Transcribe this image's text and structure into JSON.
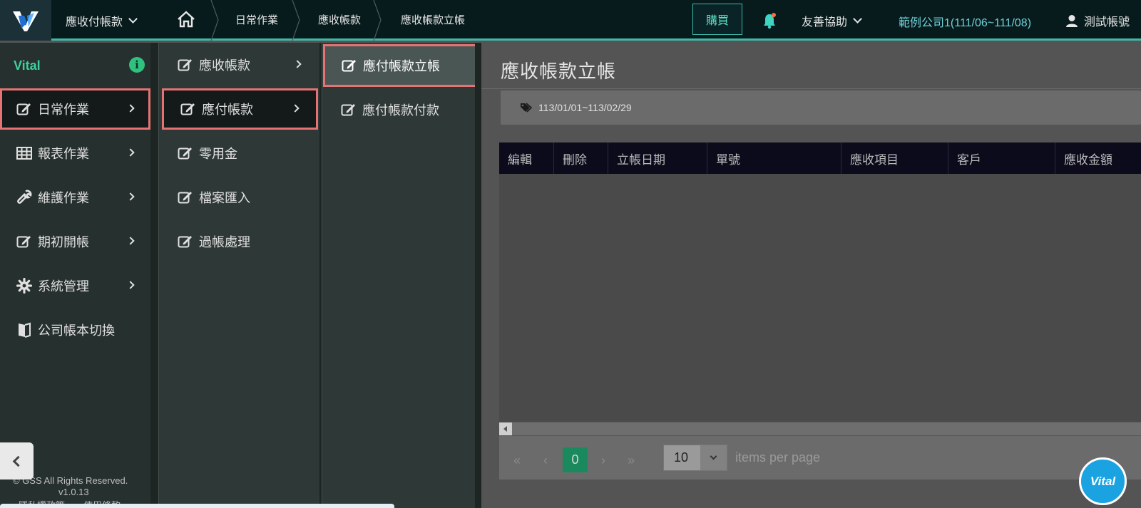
{
  "topbar": {
    "module": "應收付帳款",
    "breadcrumb": [
      "日常作業",
      "應收帳款",
      "應收帳款立帳"
    ],
    "buy_label": "購買",
    "help_label": "友善協助",
    "company": "範例公司1(111/06~111/08)",
    "user": "測試帳號"
  },
  "sidebar": {
    "brand": "Vital",
    "items": [
      {
        "label": "日常作業",
        "icon": "edit-icon"
      },
      {
        "label": "報表作業",
        "icon": "table-icon"
      },
      {
        "label": "維護作業",
        "icon": "wrench-icon"
      },
      {
        "label": "期初開帳",
        "icon": "edit-icon"
      },
      {
        "label": "系統管理",
        "icon": "gear-icon"
      },
      {
        "label": "公司帳本切換",
        "icon": "book-icon"
      }
    ],
    "footer": {
      "copyright": "© GSS All Rights Reserved.",
      "version": "v1.0.13",
      "links": "隱私權政策　　使用條款"
    }
  },
  "submenu": {
    "items": [
      {
        "label": "應收帳款"
      },
      {
        "label": "應付帳款"
      },
      {
        "label": "零用金"
      },
      {
        "label": "檔案匯入"
      },
      {
        "label": "過帳處理"
      }
    ]
  },
  "leafmenu": {
    "items": [
      {
        "label": "應付帳款立帳"
      },
      {
        "label": "應付帳款付款"
      }
    ]
  },
  "main": {
    "title": "應收帳款立帳",
    "filter_tag": "113/01/01~113/02/29",
    "columns": [
      "編輯",
      "刪除",
      "立帳日期",
      "單號",
      "應收項目",
      "客戶",
      "應收金額"
    ],
    "pager": {
      "current": "0",
      "page_size": "10",
      "items_per_page": "items per page"
    }
  },
  "fab_label": "Vital",
  "colors": {
    "accent": "#3fb9a8",
    "highlight_border": "#e57373",
    "topbar_bg": "#071a1c"
  }
}
